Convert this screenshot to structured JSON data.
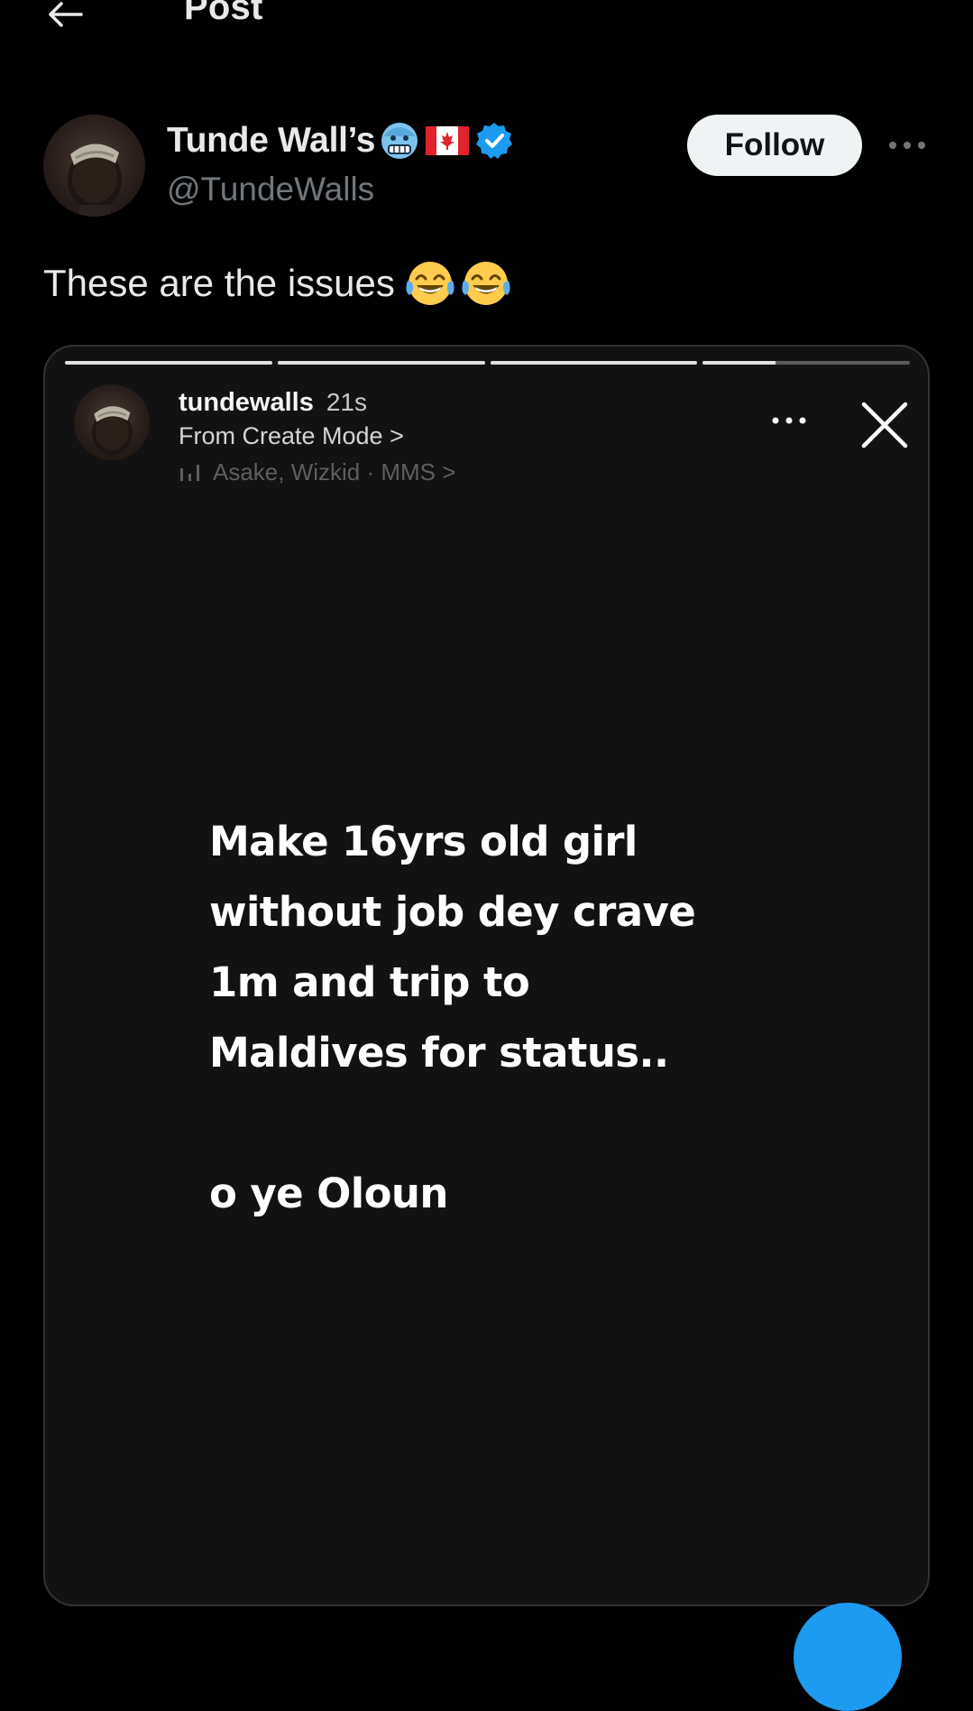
{
  "header": {
    "title": "Post",
    "back_icon": "arrow-left-icon"
  },
  "author": {
    "display_name": "Tunde Wall’s",
    "handle": "@TundeWalls",
    "badges": [
      "cold-face-emoji",
      "canada-flag-emoji",
      "verified-badge-icon"
    ],
    "follow_label": "Follow"
  },
  "tweet": {
    "text": "These are the issues",
    "emojis": [
      "tears-of-joy-emoji",
      "tears-of-joy-emoji"
    ]
  },
  "story": {
    "progress": [
      1,
      1,
      1,
      0.35
    ],
    "username": "tundewalls",
    "time": "21s",
    "source": "From Create Mode >",
    "music": "Asake, Wizkid · MMS >",
    "lines": [
      "Make 16yrs old girl",
      "without job dey crave",
      "1m and trip to",
      "Maldives for status..",
      "",
      "o ye Oloun"
    ]
  },
  "colors": {
    "background": "#000000",
    "text_primary": "#e7e9ea",
    "text_secondary": "#71767b",
    "verified_blue": "#1d9bf0",
    "follow_bg": "#eff3f4",
    "card_bg": "#121212"
  }
}
